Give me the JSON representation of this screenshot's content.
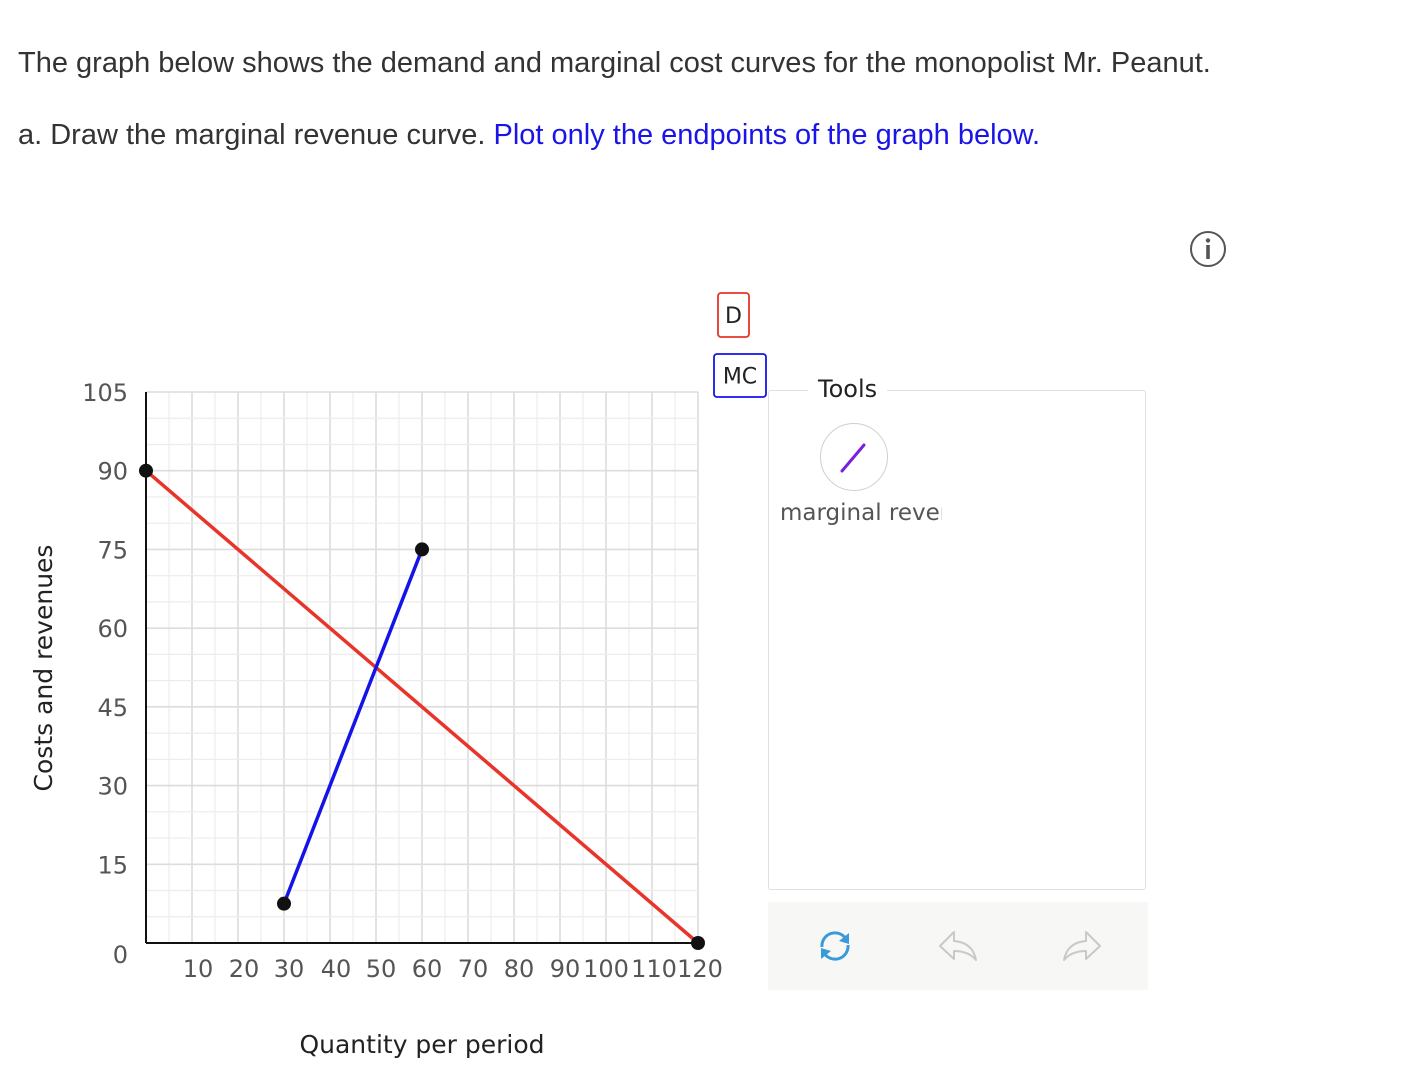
{
  "question": {
    "line1": "The graph below shows the demand and marginal cost curves for the monopolist Mr. Peanut.",
    "line2_prefix": "a. Draw the marginal revenue curve.",
    "line2_highlight": "Plot only the endpoints of the graph below."
  },
  "info_icon": "info-icon",
  "chart_data": {
    "type": "line",
    "xlabel": "Quantity per period",
    "ylabel": "Costs and revenues",
    "xlim": [
      0,
      120
    ],
    "ylim": [
      0,
      105
    ],
    "x_ticks": [
      10,
      20,
      30,
      40,
      50,
      60,
      70,
      80,
      90,
      100,
      110,
      120
    ],
    "x_tick_labels": [
      "10",
      "20",
      "30",
      "40",
      "50",
      "60",
      "70",
      "80",
      "90",
      "100",
      "110",
      "120"
    ],
    "y_ticks": [
      0,
      15,
      30,
      45,
      60,
      75,
      90,
      105
    ],
    "y_tick_labels": [
      "0",
      "15",
      "30",
      "45",
      "60",
      "75",
      "90",
      "105"
    ],
    "grid": true,
    "series": [
      {
        "name": "D",
        "color": "#e8342a",
        "points": [
          [
            0,
            90
          ],
          [
            120,
            0
          ]
        ]
      },
      {
        "name": "MC",
        "color": "#1414e8",
        "points": [
          [
            30,
            7.5
          ],
          [
            60,
            75
          ]
        ]
      }
    ],
    "legend": [
      {
        "label": "D",
        "color": "#e8342a"
      },
      {
        "label": "MC",
        "color": "#1414e8"
      }
    ]
  },
  "tools": {
    "title": "Tools",
    "items": [
      {
        "label": "marginal revenue",
        "icon": "line-tool-icon",
        "color": "#7a1ee0"
      }
    ]
  },
  "actions": {
    "reset_icon": "reset-icon",
    "undo_icon": "undo-icon",
    "redo_icon": "redo-icon"
  }
}
